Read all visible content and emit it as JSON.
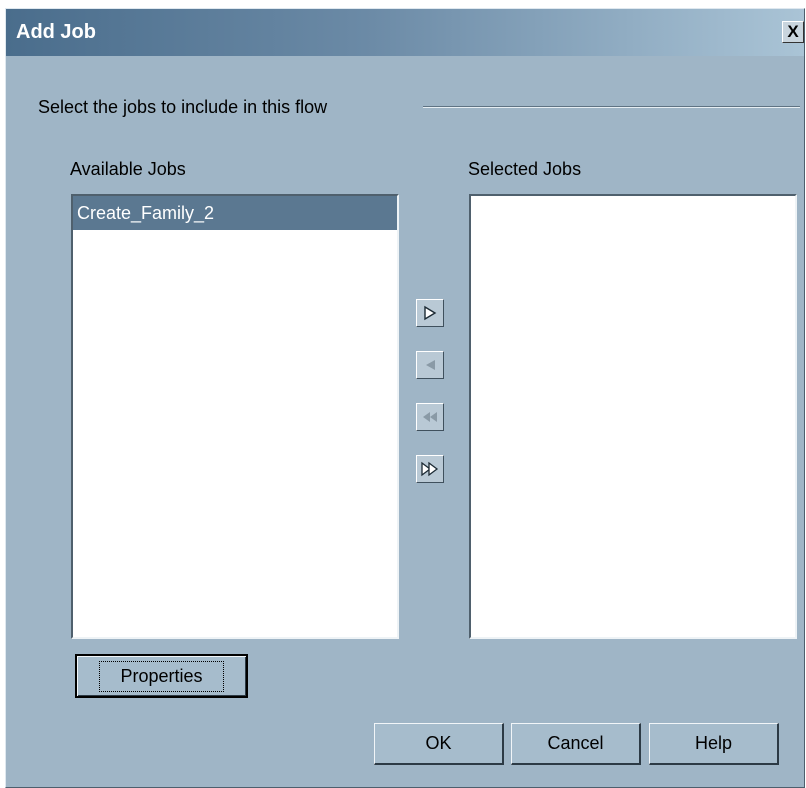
{
  "window": {
    "title": "Add Job",
    "close_glyph": "X"
  },
  "group": {
    "label": "Select the jobs to include in this flow"
  },
  "available": {
    "label": "Available Jobs",
    "items": [
      {
        "text": "Create_Family_2",
        "selected": true
      }
    ]
  },
  "selected": {
    "label": "Selected Jobs",
    "items": []
  },
  "transfer_buttons": [
    {
      "name": "move-right-icon",
      "enabled": true
    },
    {
      "name": "move-left-icon",
      "enabled": false
    },
    {
      "name": "move-all-left-icon",
      "enabled": false
    },
    {
      "name": "move-all-right-icon",
      "enabled": true
    }
  ],
  "buttons": {
    "properties": "Properties",
    "ok": "OK",
    "cancel": "Cancel",
    "help": "Help"
  },
  "colors": {
    "dialog_bg": "#9fb5c6",
    "title_gradient_start": "#4a6d8c",
    "selection": "#5b7891",
    "disabled_arrow": "#8a9aa6"
  }
}
